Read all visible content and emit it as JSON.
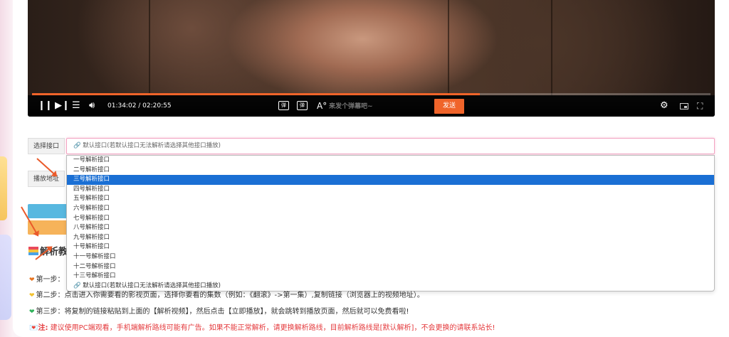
{
  "player": {
    "time": "01:34:02 / 02:20:55",
    "progress": 0.66,
    "danmaku_placeholder": "来发个弹幕吧~",
    "danmaku_toggle_label": "弹",
    "danmaku_setting_label": "弹",
    "font_icon": "A°",
    "send_label": "发送",
    "icons": [
      "pause-icon",
      "next-icon",
      "playlist-icon",
      "volume-icon",
      "gear-icon",
      "pip-icon",
      "fullscreen-icon"
    ],
    "accent_color": "#f0642a"
  },
  "form": {
    "interface_label": "选择接口",
    "address_label": "播放地址",
    "selected_value": "🔗 默认接口(若默认接口无法解析请选择其他接口播放)",
    "options": [
      "一号解析接口",
      "二号解析接口",
      "三号解析接口",
      "四号解析接口",
      "五号解析接口",
      "六号解析接口",
      "七号解析接口",
      "八号解析接口",
      "九号解析接口",
      "十号解析接口",
      "十一号解析接口",
      "十二号解析接口",
      "十三号解析接口",
      "🔗 默认接口(若默认接口无法解析请选择其他接口播放)"
    ],
    "highlighted_index": 2,
    "highlight_color": "#1a6fd4"
  },
  "tutorial": {
    "title": "解析教",
    "step1": "第一步：",
    "step2": "第二步：点击进入你需要看的影视页面，选择你要看的集数（例如：《翻滚》->第一集）,复制链接（浏览器上的视频地址）。",
    "step3": "第三步：将复制的链接粘贴到上面的【解析视频】，然后点击【立即播放】，就会跳转到播放页面，然后就可以免费看啦!",
    "note_label": "注:",
    "note_text": " 建议使用PC端观看，手机端解析路线可能有广告。如果不能正常解析，请更换解析路线，目前解析路线是[默认解析]，不会更换的请联系站长!",
    "note_color": "#e4393c"
  }
}
